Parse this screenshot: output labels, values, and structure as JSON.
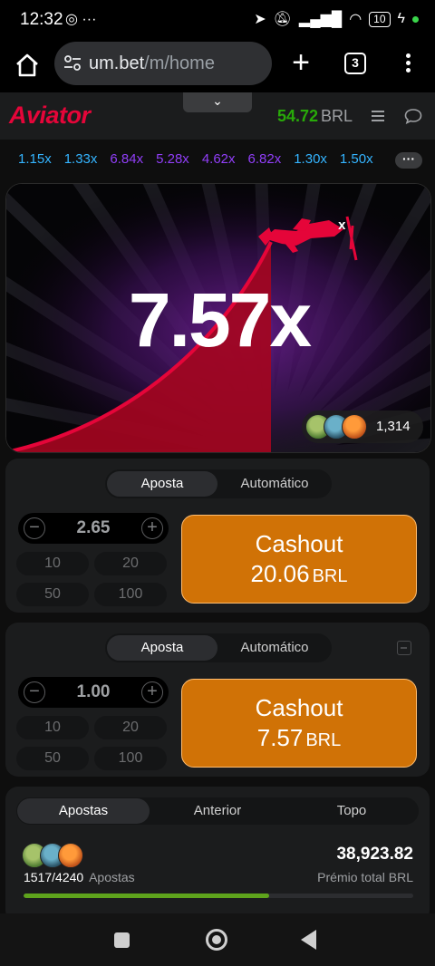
{
  "status_bar": {
    "time": "12:32",
    "left_icons": "◎ ···",
    "battery": "10"
  },
  "browser": {
    "url_host": "um.bet",
    "url_path": "/m/home",
    "tab_count": "3"
  },
  "game_header": {
    "logo": "Aviator",
    "collapse_glyph": "⌄",
    "balance_amount": "54.72",
    "balance_currency": "BRL"
  },
  "history": [
    {
      "value": "1.15x",
      "color": "#34b4ff"
    },
    {
      "value": "1.33x",
      "color": "#34b4ff"
    },
    {
      "value": "6.84x",
      "color": "#913ef8"
    },
    {
      "value": "5.28x",
      "color": "#913ef8"
    },
    {
      "value": "4.62x",
      "color": "#913ef8"
    },
    {
      "value": "6.82x",
      "color": "#913ef8"
    },
    {
      "value": "1.30x",
      "color": "#34b4ff"
    },
    {
      "value": "1.50x",
      "color": "#34b4ff"
    }
  ],
  "history_more": "···",
  "game": {
    "multiplier": "7.57x",
    "players_count": "1,314"
  },
  "panels": [
    {
      "tabs": [
        "Aposta",
        "Automático"
      ],
      "active_tab": 0,
      "amount": "2.65",
      "minus": "−",
      "plus": "+",
      "quick": [
        "10",
        "20",
        "50",
        "100"
      ],
      "cashout_label": "Cashout",
      "cashout_amount": "20.06",
      "cashout_currency": "BRL"
    },
    {
      "tabs": [
        "Aposta",
        "Automático"
      ],
      "active_tab": 0,
      "amount": "1.00",
      "minus": "−",
      "plus": "+",
      "quick": [
        "10",
        "20",
        "50",
        "100"
      ],
      "cashout_label": "Cashout",
      "cashout_amount": "7.57",
      "cashout_currency": "BRL"
    }
  ],
  "bets": {
    "tabs": [
      "Apostas",
      "Anterior",
      "Topo"
    ],
    "active_tab": 0,
    "total": "38,923.82",
    "total_label": "Prémio total BRL",
    "ratio": "1517/4240",
    "ratio_label": "Apostas",
    "progress_fraction": 0.63
  },
  "colors": {
    "accent_red": "#e50539",
    "balance_green": "#28a909",
    "cashout_orange": "#d07206"
  }
}
